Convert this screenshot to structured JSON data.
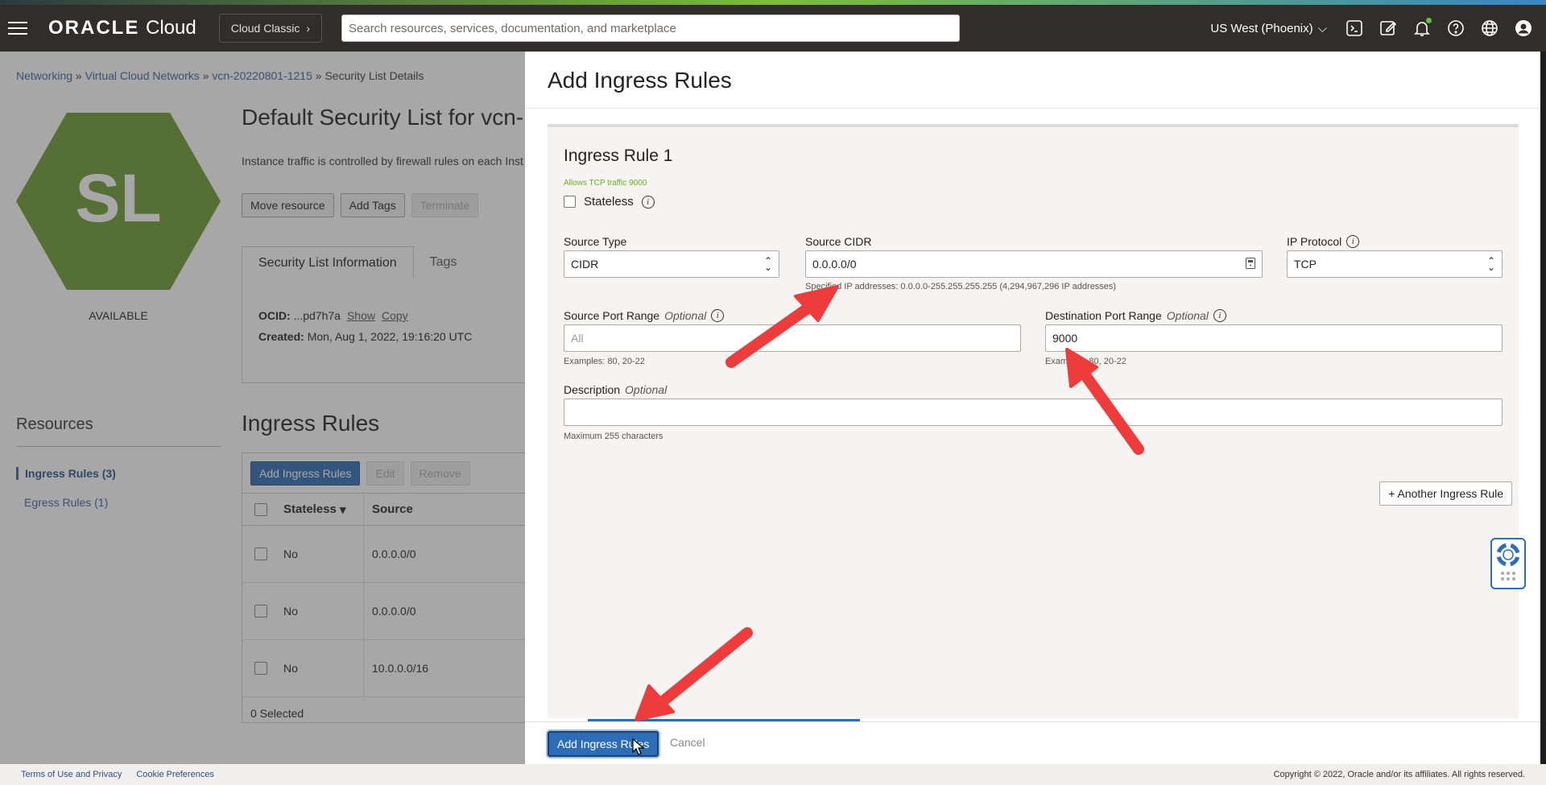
{
  "topbar": {
    "logo_brand": "ORACLE",
    "logo_product": "Cloud",
    "classic_label": "Cloud Classic",
    "search_placeholder": "Search resources, services, documentation, and marketplace",
    "region": "US West (Phoenix)"
  },
  "background_page": {
    "breadcrumb": [
      "Networking",
      "Virtual Cloud Networks",
      "vcn-20220801-1215",
      "Security List Details"
    ],
    "hex_label": "SL",
    "status": "AVAILABLE",
    "title": "Default Security List for vcn-",
    "description": "Instance traffic is controlled by firewall rules on each Inst",
    "actions": [
      "Move resource",
      "Add Tags",
      "Terminate"
    ],
    "tabs": [
      "Security List Information",
      "Tags"
    ],
    "info": {
      "ocid_label": "OCID:",
      "ocid_value": "...pd7h7a",
      "show": "Show",
      "copy": "Copy",
      "created_label": "Created:",
      "created_value": "Mon, Aug 1, 2022, 19:16:20 UTC"
    },
    "resources_title": "Resources",
    "resources": [
      "Ingress Rules (3)",
      "Egress Rules (1)"
    ],
    "ingress_title": "Ingress Rules",
    "table_actions": [
      "Add Ingress Rules",
      "Edit",
      "Remove"
    ],
    "columns": [
      "Stateless",
      "Source"
    ],
    "rows": [
      {
        "stateless": "No",
        "source": "0.0.0.0/0"
      },
      {
        "stateless": "No",
        "source": "0.0.0.0/0"
      },
      {
        "stateless": "No",
        "source": "10.0.0.0/16"
      }
    ],
    "selected": "0 Selected"
  },
  "panel": {
    "title": "Add Ingress Rules",
    "rule_heading": "Ingress Rule 1",
    "rule_subtitle": "Allows TCP traffic 9000",
    "stateless_label": "Stateless",
    "source_type_label": "Source Type",
    "source_type_value": "CIDR",
    "source_cidr_label": "Source CIDR",
    "source_cidr_value": "0.0.0.0/0",
    "source_cidr_hint": "Specified IP addresses: 0.0.0.0-255.255.255.255 (4,294,967,296 IP addresses)",
    "ip_protocol_label": "IP Protocol",
    "ip_protocol_value": "TCP",
    "src_port_label": "Source Port Range",
    "optional": "Optional",
    "src_port_placeholder": "All",
    "src_port_hint": "Examples: 80, 20-22",
    "dst_port_label": "Destination Port Range",
    "dst_port_value": "9000",
    "dst_port_hint": "Examples: 80, 20-22",
    "description_label": "Description",
    "description_hint": "Maximum 255 characters",
    "another_rule": "+ Another Ingress Rule",
    "submit": "Add Ingress Rules",
    "cancel": "Cancel"
  },
  "footer": {
    "terms": "Terms of Use and Privacy",
    "cookies": "Cookie Preferences",
    "copyright": "Copyright © 2022, Oracle and/or its affiliates. All rights reserved."
  },
  "colors": {
    "topbar": "#312d2a",
    "accent_blue": "#2e6cb5",
    "hex_green": "#5f8c2a",
    "annotation_red": "#ee3b3b"
  }
}
